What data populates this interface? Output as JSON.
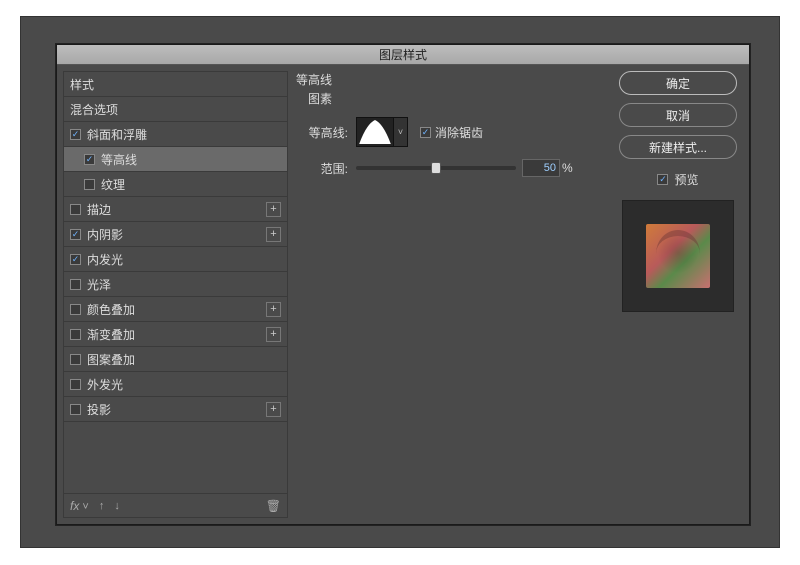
{
  "window": {
    "title": "图层样式"
  },
  "left": {
    "styles": "样式",
    "blendOptions": "混合选项",
    "bevel": "斜面和浮雕",
    "contour": "等高线",
    "texture": "纹理",
    "stroke": "描边",
    "innerShadow": "内阴影",
    "innerGlow": "内发光",
    "satin": "光泽",
    "colorOverlay": "颜色叠加",
    "gradientOverlay": "渐变叠加",
    "patternOverlay": "图案叠加",
    "outerGlow": "外发光",
    "dropShadow": "投影"
  },
  "center": {
    "sectionTitle": "等高线",
    "subLabel": "图素",
    "contourLabel": "等高线:",
    "antiAlias": "消除锯齿",
    "rangeLabel": "范围:",
    "rangeValue": "50",
    "rangePct": "%"
  },
  "right": {
    "ok": "确定",
    "cancel": "取消",
    "newStyle": "新建样式...",
    "preview": "预览"
  },
  "footer": {
    "fx": "fx"
  }
}
